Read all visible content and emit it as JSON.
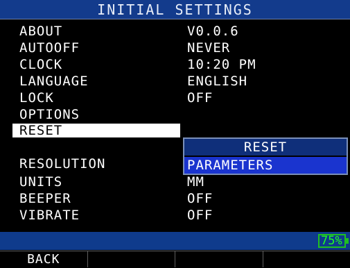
{
  "title": "INITIAL SETTINGS",
  "menu": [
    {
      "label": "ABOUT",
      "value": "V0.0.6"
    },
    {
      "label": "AUTOOFF",
      "value": "NEVER"
    },
    {
      "label": "CLOCK",
      "value": "10:20 PM"
    },
    {
      "label": "LANGUAGE",
      "value": "ENGLISH"
    },
    {
      "label": "LOCK",
      "value": "OFF"
    },
    {
      "label": "OPTIONS",
      "value": ""
    },
    {
      "label": "RESET",
      "value": ""
    },
    {
      "label": "RESOLUTION",
      "value": ""
    },
    {
      "label": "UNITS",
      "value": "MM"
    },
    {
      "label": "BEEPER",
      "value": "OFF"
    },
    {
      "label": "VIBRATE",
      "value": "OFF"
    }
  ],
  "popup": {
    "header": "RESET",
    "option": "PARAMETERS"
  },
  "status": {
    "battery": "75%"
  },
  "softkeys": [
    "BACK",
    "",
    "",
    ""
  ],
  "colors": {
    "title_bg": "#133b8c",
    "status_bg": "#0f3b8c",
    "popup_header_bg": "#0f2f7a",
    "popup_option_bg": "#1a34cf",
    "battery": "#20ff20"
  }
}
